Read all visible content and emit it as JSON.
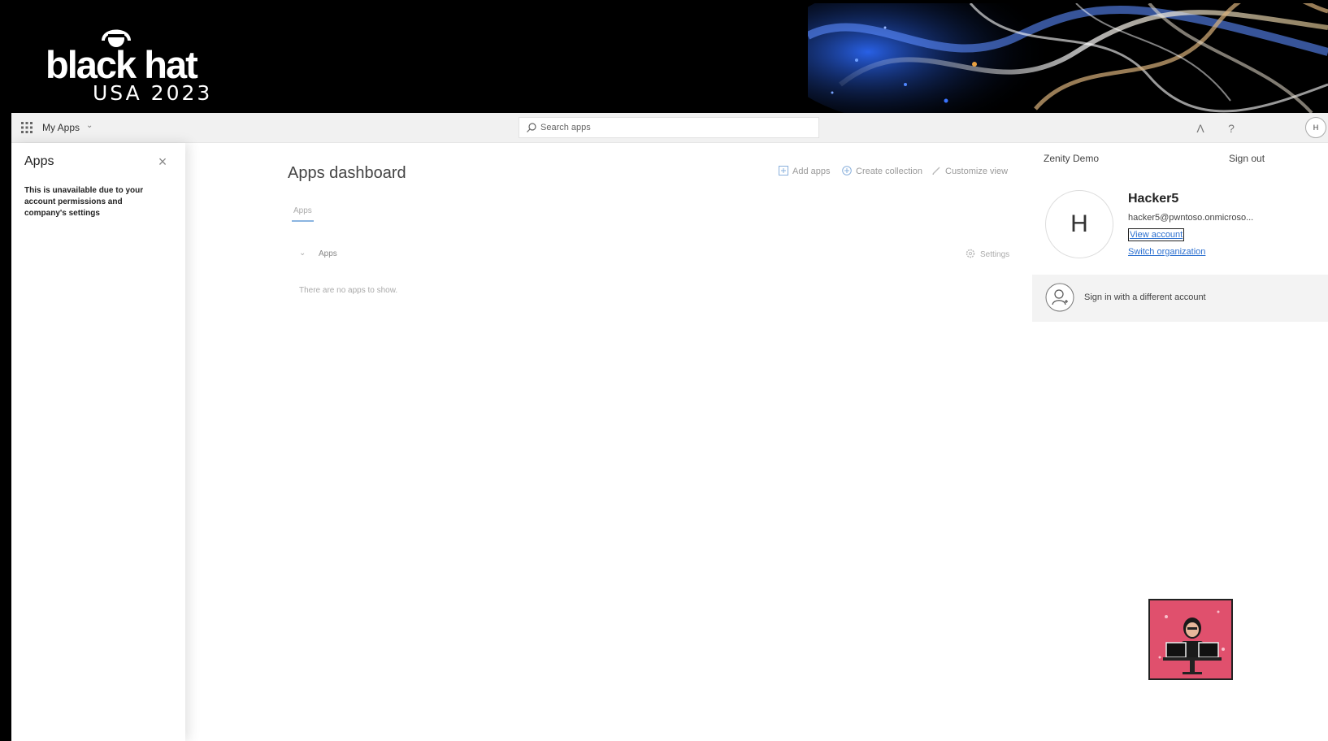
{
  "banner": {
    "brand": "black hat",
    "event": "USA 2023"
  },
  "topbar": {
    "app_name": "My Apps",
    "search_placeholder": "Search apps",
    "avatar_initial": "H"
  },
  "left_panel": {
    "title": "Apps",
    "message": "This is unavailable due to your account permissions and company's settings"
  },
  "main": {
    "title": "Apps dashboard",
    "actions": [
      "Add apps",
      "Create collection",
      "Customize view"
    ],
    "tab": "Apps",
    "group_label": "Apps",
    "settings_label": "Settings",
    "empty_message": "There are no apps to show."
  },
  "account": {
    "organization": "Zenity Demo",
    "sign_out": "Sign out",
    "avatar_initial": "H",
    "name": "Hacker5",
    "email": "hacker5@pwntoso.onmicroso...",
    "view_account": "View account",
    "switch_organization": "Switch organization",
    "different_account": "Sign in with a different account"
  },
  "colors": {
    "link": "#2b6fcf",
    "overlay_pink": "#e0506d"
  }
}
